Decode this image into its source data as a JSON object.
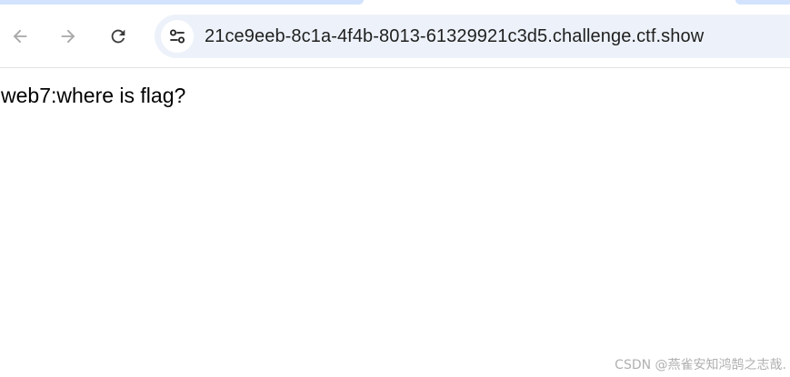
{
  "browser": {
    "address_bar": {
      "url": "21ce9eeb-8c1a-4f4b-8013-61329921c3d5.challenge.ctf.show"
    },
    "icons": {
      "back": "arrow-left-icon",
      "forward": "arrow-right-icon",
      "reload": "reload-icon",
      "site_info": "tune-icon"
    }
  },
  "page": {
    "text": "web7:where is flag?"
  },
  "watermark": {
    "text": "CSDN @燕雀安知鸿鹄之志哉."
  }
}
